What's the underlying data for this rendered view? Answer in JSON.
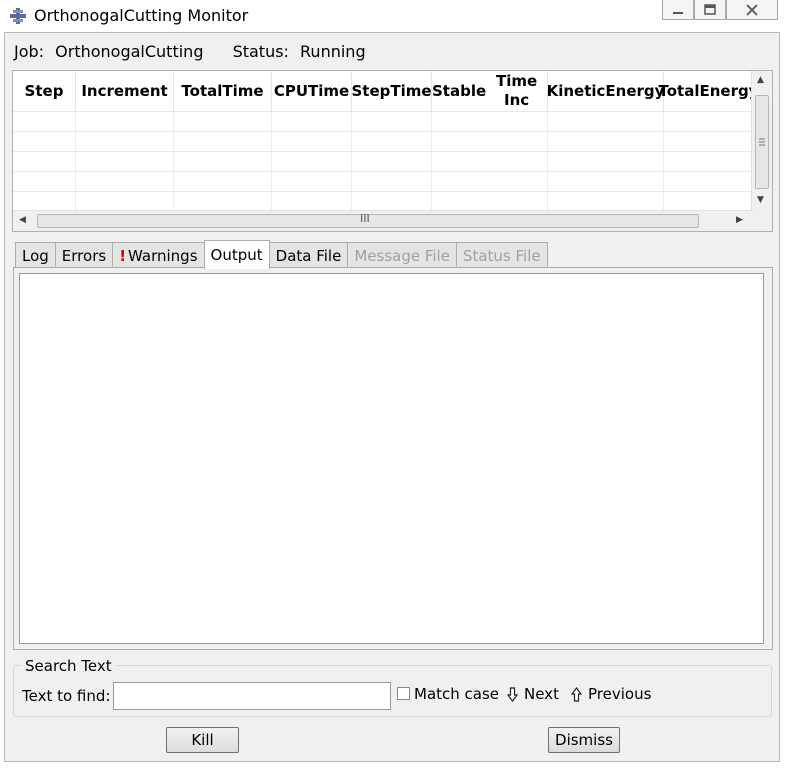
{
  "window": {
    "title": "OrthonogalCutting Monitor"
  },
  "job": {
    "job_label": "Job:",
    "job_name": "OrthonogalCutting",
    "status_label": "Status:",
    "status_value": "Running"
  },
  "table": {
    "columns": [
      {
        "line1": "Step",
        "line2": ""
      },
      {
        "line1": "Increment",
        "line2": ""
      },
      {
        "line1": "Total",
        "line2": "Time"
      },
      {
        "line1": "CPU",
        "line2": "Time"
      },
      {
        "line1": "Step",
        "line2": "Time"
      },
      {
        "line1": "Stable",
        "line2": "Time Inc"
      },
      {
        "line1": "Kinetic",
        "line2": "Energy"
      },
      {
        "line1": "Total",
        "line2": "Energy"
      }
    ],
    "hscroll_grip": "III"
  },
  "tabs": [
    {
      "label": "Log",
      "state": "normal"
    },
    {
      "label": "Errors",
      "state": "normal"
    },
    {
      "label": "Warnings",
      "state": "warning"
    },
    {
      "label": "Output",
      "state": "active"
    },
    {
      "label": "Data File",
      "state": "normal"
    },
    {
      "label": "Message File",
      "state": "disabled"
    },
    {
      "label": "Status File",
      "state": "disabled"
    }
  ],
  "warning_mark": "!",
  "search": {
    "group_title": "Search Text",
    "find_label": "Text to find:",
    "find_value": "",
    "match_case_label": "Match case",
    "next_label": "Next",
    "previous_label": "Previous"
  },
  "buttons": {
    "kill": "Kill",
    "dismiss": "Dismiss"
  },
  "icons": {
    "app": "abaqus-icon",
    "minimize": "minimize-icon",
    "maximize": "maximize-icon",
    "close": "close-icon",
    "next": "arrow-down-icon",
    "previous": "arrow-up-icon"
  },
  "colors": {
    "warning": "#d40000",
    "disabled_text": "#a0a0a0",
    "frame": "#f0f0f0"
  }
}
